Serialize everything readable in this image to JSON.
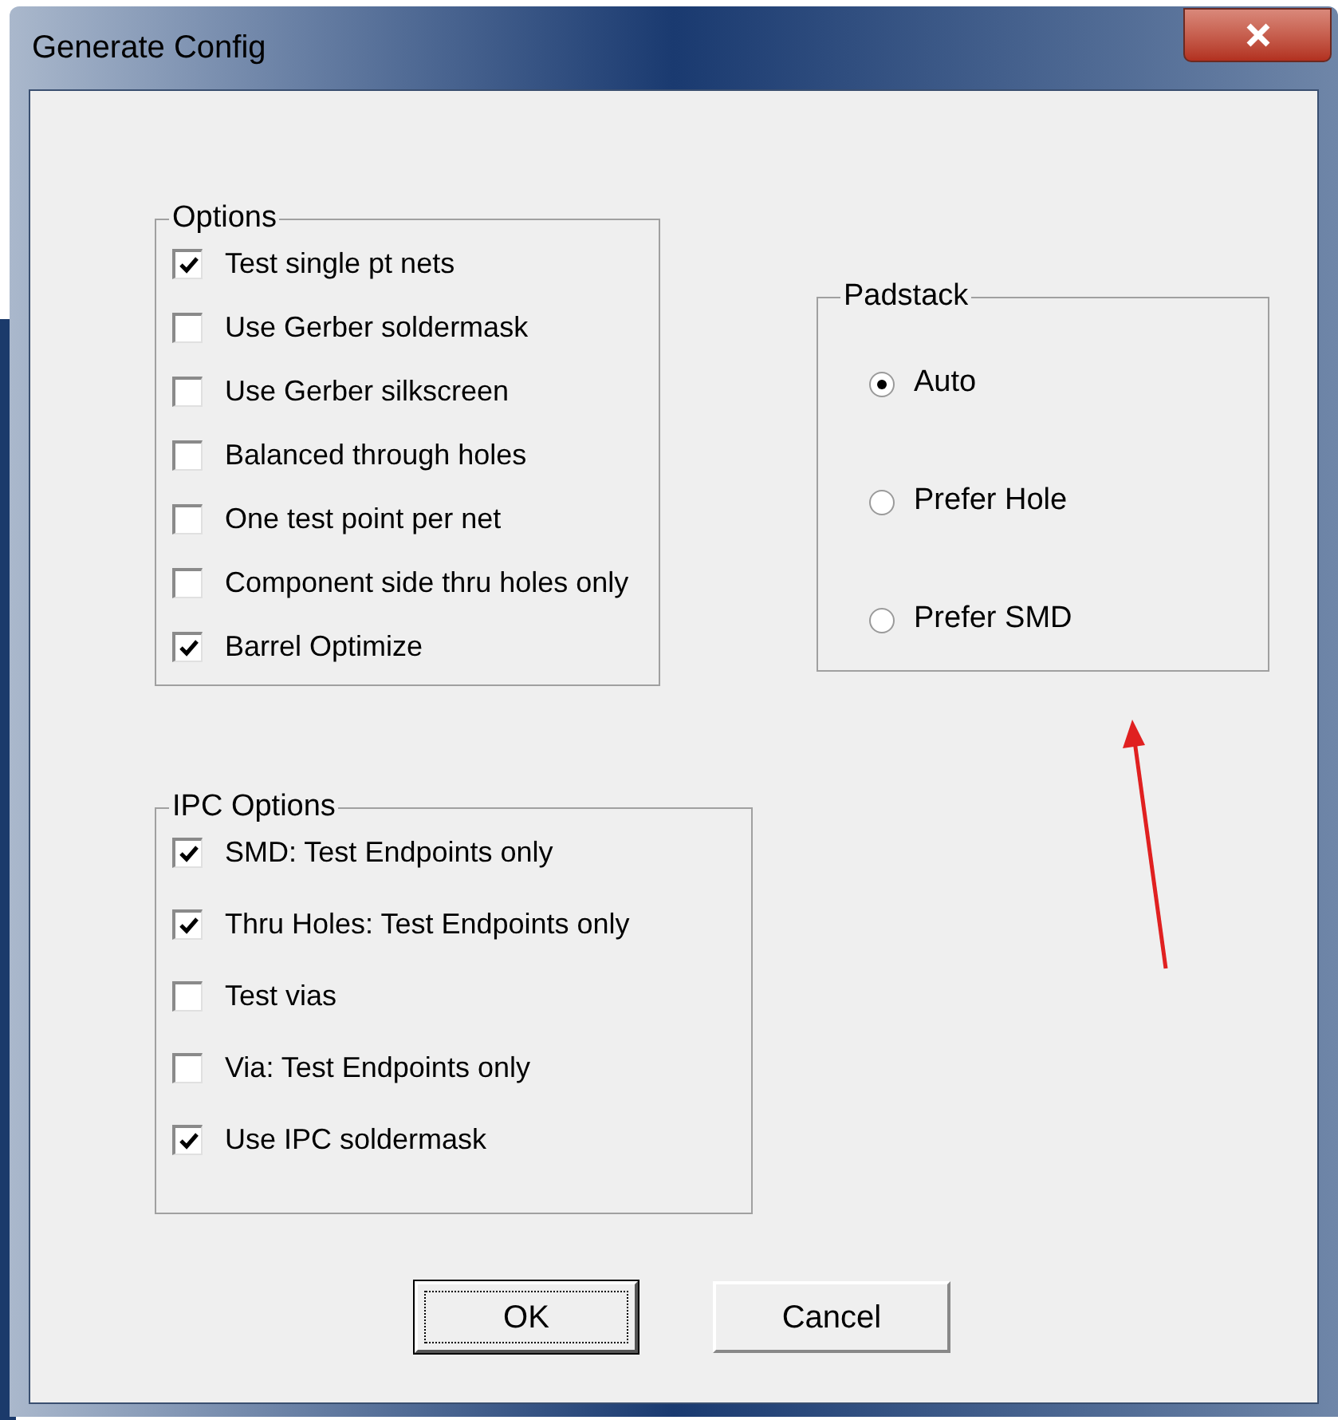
{
  "window": {
    "title": "Generate Config"
  },
  "options": {
    "label": "Options",
    "items": [
      {
        "label": "Test single pt nets",
        "checked": true
      },
      {
        "label": "Use Gerber soldermask",
        "checked": false
      },
      {
        "label": "Use Gerber silkscreen",
        "checked": false
      },
      {
        "label": "Balanced through holes",
        "checked": false
      },
      {
        "label": "One test point per net",
        "checked": false
      },
      {
        "label": "Component side thru holes only",
        "checked": false
      },
      {
        "label": "Barrel Optimize",
        "checked": true
      }
    ]
  },
  "ipc_options": {
    "label": "IPC Options",
    "items": [
      {
        "label": "SMD: Test Endpoints only",
        "checked": true
      },
      {
        "label": "Thru Holes: Test Endpoints only",
        "checked": true
      },
      {
        "label": "Test vias",
        "checked": false
      },
      {
        "label": "Via: Test Endpoints only",
        "checked": false
      },
      {
        "label": "Use IPC soldermask",
        "checked": true
      }
    ]
  },
  "padstack": {
    "label": "Padstack",
    "items": [
      {
        "label": "Auto",
        "selected": true
      },
      {
        "label": "Prefer Hole",
        "selected": false
      },
      {
        "label": "Prefer SMD",
        "selected": false
      }
    ]
  },
  "buttons": [
    {
      "label": "OK",
      "focused": true
    },
    {
      "label": "Cancel",
      "focused": false
    }
  ]
}
